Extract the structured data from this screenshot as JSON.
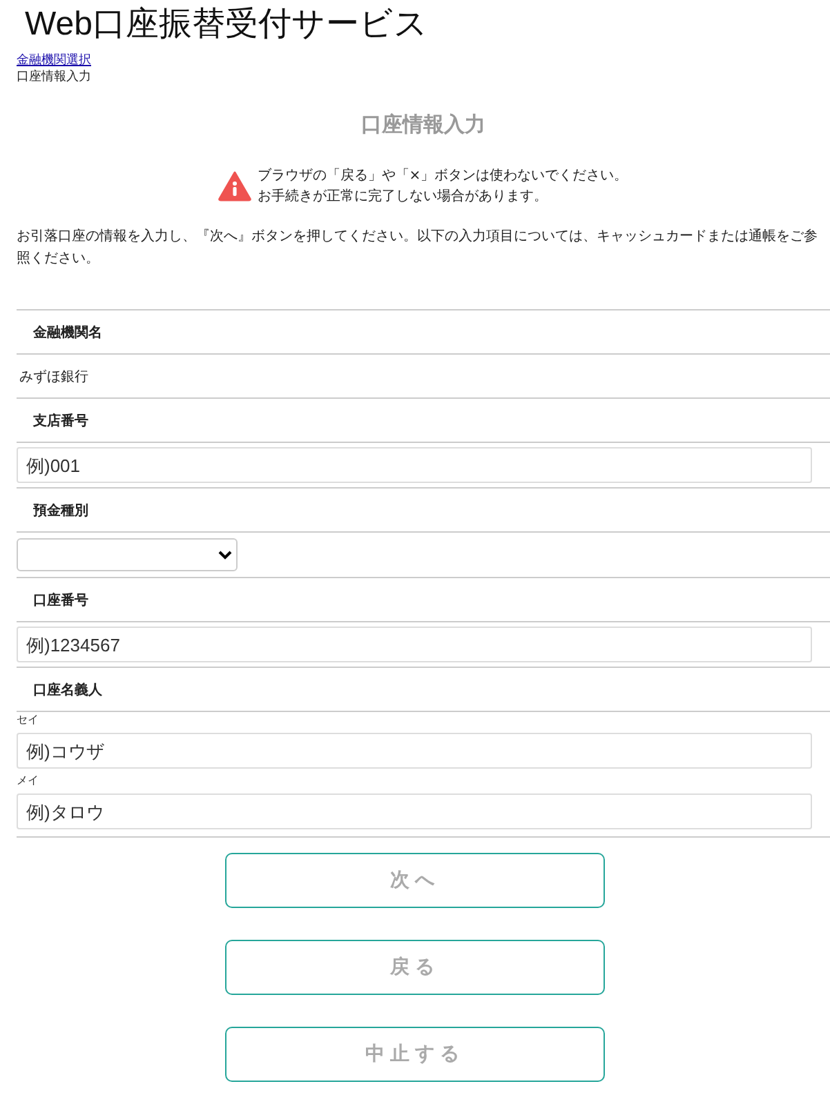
{
  "title": "Web口座振替受付サービス",
  "breadcrumb": [
    {
      "label": "金融機関選択",
      "kind": "link"
    },
    {
      "label": "口座情報入力",
      "kind": "current"
    }
  ],
  "heading": "口座情報入力",
  "warning": [
    "ブラウザの「戻る」や「×」ボタンは使わないでください。",
    "お手続きが正常に完了しない場合があります。"
  ],
  "intro": "お引落口座の情報を入力し、『次へ』ボタンを押してください。以下の入力項目については、キャッシュカードまたは通帳をご参照ください。",
  "fields": [
    {
      "label": "金融機関名",
      "kind": "text",
      "value": "みずほ銀行"
    },
    {
      "label": "支店番号",
      "kind": "input",
      "placeholder": "例)001"
    },
    {
      "label": "預金種別",
      "kind": "select"
    },
    {
      "label": "口座番号",
      "kind": "input",
      "placeholder": "例)1234567"
    },
    {
      "label": "口座名義人",
      "kind": "name",
      "parts": [
        {
          "caption": "セイ",
          "placeholder": "例)コウザ"
        },
        {
          "caption": "メイ",
          "placeholder": "例)タロウ"
        }
      ]
    }
  ],
  "buttons": [
    "次へ",
    "戻る",
    "中止する"
  ]
}
